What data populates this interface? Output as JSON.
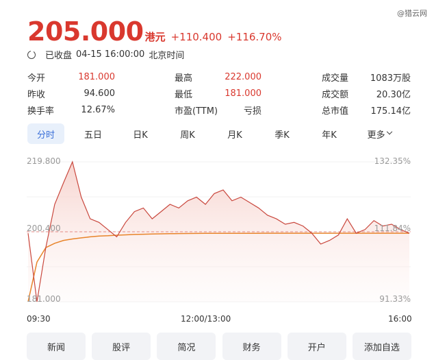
{
  "watermark": "@猎云网",
  "quote": {
    "price": "205.000",
    "currency": "港元",
    "change": "+110.400",
    "change_pct": "+116.70%",
    "status": "已收盘",
    "datetime": "04-15 16:00:00",
    "timezone": "北京时间"
  },
  "stats": [
    [
      {
        "label": "今开",
        "value": "181.000",
        "color": "red"
      },
      {
        "label": "最高",
        "value": "222.000",
        "color": "red"
      },
      {
        "label": "成交量",
        "value": "1083万股"
      }
    ],
    [
      {
        "label": "昨收",
        "value": "94.600"
      },
      {
        "label": "最低",
        "value": "181.000",
        "color": "red"
      },
      {
        "label": "成交额",
        "value": "20.30亿"
      }
    ],
    [
      {
        "label": "换手率",
        "value": "12.67%"
      },
      {
        "label": "市盈(TTM)",
        "value": "亏损"
      },
      {
        "label": "总市值",
        "value": "175.14亿"
      }
    ]
  ],
  "tabs": [
    "分时",
    "五日",
    "日K",
    "周K",
    "月K",
    "季K",
    "年K",
    "更多"
  ],
  "active_tab": "分时",
  "chart": {
    "y_left_top": "219.800",
    "y_left_mid": "200.400",
    "y_left_bottom": "181.000",
    "y_right_top": "132.35%",
    "y_right_mid": "111.84%",
    "y_right_bottom": "91.33%",
    "x_start": "09:30",
    "x_mid": "12:00/13:00",
    "x_end": "16:00"
  },
  "chart_data": {
    "type": "line",
    "ylim": [
      181.0,
      219.8
    ],
    "reference": 200.4,
    "series": [
      {
        "values": [
          200.0,
          181.0,
          196.0,
          208.0,
          214.0,
          219.8,
          210.0,
          204.0,
          203.0,
          201.0,
          199.0,
          203.0,
          206.0,
          207.0,
          204.0,
          206.0,
          208.0,
          207.0,
          209.0,
          210.0,
          208.0,
          211.0,
          212.0,
          209.0,
          210.0,
          208.5,
          207.0,
          205.0,
          204.0,
          202.5,
          203.0,
          202.0,
          200.0,
          197.0,
          198.0,
          199.5,
          204.0,
          200.0,
          201.0,
          203.5,
          202.0,
          202.5,
          201.0,
          200.0
        ]
      },
      {
        "values": [
          181.0,
          192.0,
          196.0,
          197.2,
          198.0,
          198.4,
          198.7,
          199.0,
          199.2,
          199.3,
          199.45,
          199.55,
          199.65,
          199.72,
          199.78,
          199.83,
          199.87,
          199.9,
          199.93,
          199.95,
          199.96,
          199.97,
          199.97,
          199.98,
          199.98,
          199.99,
          199.99,
          200.0,
          200.0,
          200.0,
          200.0,
          200.0,
          200.0,
          200.0,
          200.0,
          200.0,
          200.0,
          200.0,
          200.0,
          200.0,
          200.0,
          200.0,
          200.0,
          200.0
        ]
      }
    ],
    "colors": {
      "price": "#c9473d",
      "avg": "#e8842a",
      "fill_top": "#f6cfc9",
      "ref": "#e58a84"
    }
  },
  "actions": [
    "新闻",
    "股评",
    "简况",
    "财务",
    "开户",
    "添加自选"
  ]
}
